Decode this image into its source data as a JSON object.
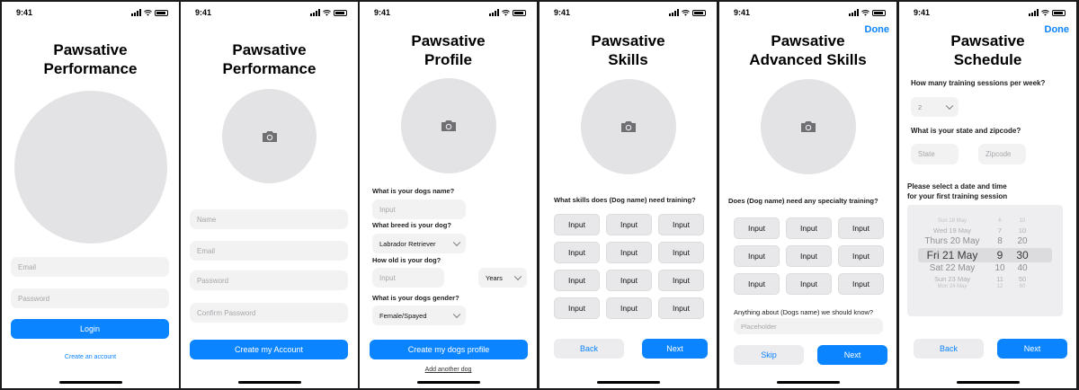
{
  "status_time": "9:41",
  "colors": {
    "accent": "#0a84ff",
    "placeholder_field": "#f2f2f3",
    "avatar": "#e3e3e5"
  },
  "screen1": {
    "title_line1": "Pawsative",
    "title_line2": "Performance",
    "email_placeholder": "Email",
    "password_placeholder": "Password",
    "login_label": "Login",
    "create_account_link": "Create an account"
  },
  "screen2": {
    "title_line1": "Pawsative",
    "title_line2": "Performance",
    "name_placeholder": "Name",
    "email_placeholder": "Email",
    "password_placeholder": "Password",
    "confirm_placeholder": "Confirm Password",
    "create_label": "Create my Account"
  },
  "screen3": {
    "title_line1": "Pawsative",
    "title_line2": "Profile",
    "q_name": "What is your dogs name?",
    "name_placeholder": "Input",
    "q_breed": "What breed is your dog?",
    "breed_value": "Labrador Retriever",
    "q_age": "How old is your dog?",
    "age_placeholder": "Input",
    "age_unit": "Years",
    "q_gender": "What is your dogs gender?",
    "gender_value": "Female/Spayed",
    "create_label": "Create my dogs profile",
    "add_link": "Add another dog"
  },
  "screen4": {
    "title_line1": "Pawsative",
    "title_line2": "Skills",
    "question": "What skills does (Dog name) need training?",
    "inputs": [
      "Input",
      "Input",
      "Input",
      "Input",
      "Input",
      "Input",
      "Input",
      "Input",
      "Input",
      "Input",
      "Input",
      "Input"
    ],
    "back_label": "Back",
    "next_label": "Next"
  },
  "screen5": {
    "done_label": "Done",
    "title_line1": "Pawsative",
    "title_line2": "Advanced Skills",
    "question": "Does (Dog name) need any specialty training?",
    "inputs": [
      "Input",
      "Input",
      "Input",
      "Input",
      "Input",
      "Input",
      "Input",
      "Input",
      "Input"
    ],
    "anything_q": "Anything about (Dogs name) we should know?",
    "anything_placeholder": "Placeholder",
    "skip_label": "Skip",
    "next_label": "Next"
  },
  "screen6": {
    "done_label": "Done",
    "title_line1": "Pawsative",
    "title_line2": "Schedule",
    "q_sessions": "How many training sessions per week?",
    "sessions_value": "2",
    "q_location": "What is your state and zipcode?",
    "state_placeholder": "State",
    "zip_placeholder": "Zipcode",
    "q_date_line1": "Please select a date and time",
    "q_date_line2": "for your first training session",
    "picker_rows": [
      {
        "date": "Sun 18 May",
        "hour": "6",
        "min": "10"
      },
      {
        "date": "Wed 19 May",
        "hour": "7",
        "min": "10"
      },
      {
        "date": "Thurs 20 May",
        "hour": "8",
        "min": "20"
      },
      {
        "date": "Fri 21 May",
        "hour": "9",
        "min": "30"
      },
      {
        "date": "Sat 22 May",
        "hour": "10",
        "min": "40"
      },
      {
        "date": "Sun 23 May",
        "hour": "11",
        "min": "50"
      },
      {
        "date": "Mon 24 May",
        "hour": "12",
        "min": "60"
      }
    ],
    "back_label": "Back",
    "next_label": "Next"
  }
}
